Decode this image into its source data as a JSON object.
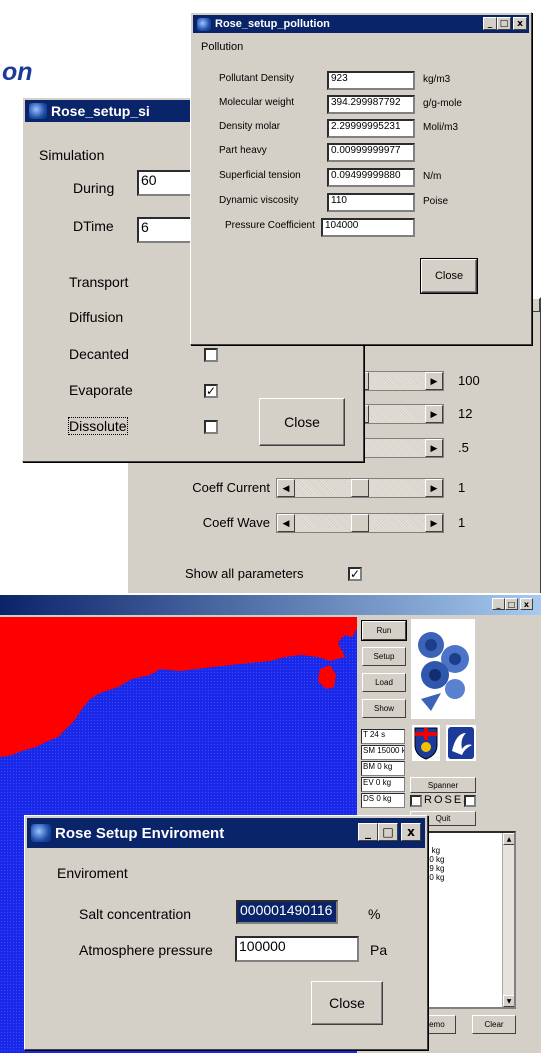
{
  "slide_title_fragment": "on",
  "sim_window": {
    "title": "Rose_setup_si",
    "group_label": "Simulation",
    "during_label": "During",
    "during_value": "60",
    "dtime_label": "DTime",
    "dtime_value": "6",
    "options": [
      {
        "label": "Transport",
        "checked": null
      },
      {
        "label": "Diffusion",
        "checked": null
      },
      {
        "label": "Decanted",
        "checked": false
      },
      {
        "label": "Evaporate",
        "checked": true
      },
      {
        "label": "Dissolute",
        "checked": false
      }
    ],
    "close_label": "Close"
  },
  "pollution_window": {
    "title": "Rose_setup_pollution",
    "group_label": "Pollution",
    "fields": [
      {
        "label": "Pollutant Density",
        "value": "923",
        "unit": "kg/m3"
      },
      {
        "label": "Molecular weight",
        "value": "394.299987792",
        "unit": "g/g-mole"
      },
      {
        "label": "Density molar",
        "value": "2.29999995231",
        "unit": "Moli/m3"
      },
      {
        "label": "Part heavy",
        "value": "0.00999999977",
        "unit": ""
      },
      {
        "label": "Superficial tension",
        "value": "0.09499999880",
        "unit": "N/m"
      },
      {
        "label": "Dynamic viscosity",
        "value": "110",
        "unit": "Poise"
      },
      {
        "label": "Pressure Coefficient",
        "value": "104000",
        "unit": ""
      }
    ],
    "close_label": "Close"
  },
  "params_window": {
    "sliders": [
      {
        "label": "",
        "value": "100",
        "level": 0.5
      },
      {
        "label": "",
        "value": "12",
        "level": 0.5
      },
      {
        "label": "",
        "value": ".5",
        "level": 0.05
      },
      {
        "label": "Coeff Current",
        "value": "1",
        "level": 0.5
      },
      {
        "label": "Coeff Wave",
        "value": "1",
        "level": 0.5
      }
    ],
    "show_all_label": "Show all parameters",
    "show_all_checked": true
  },
  "main_window": {
    "buttons": {
      "run": "Run",
      "setup": "Setup",
      "load": "Load",
      "show": "Show",
      "spanner": "Spanner",
      "quit": "Quit",
      "demo": "Demo",
      "clear": "Clear"
    },
    "status": [
      "T 24 s",
      "SM 15000 kg",
      "BM 0 kg",
      "EV 0 kg",
      "DS 0 kg"
    ],
    "roses_label": "ROSES",
    "log_lines": [
      "g",
      "000 kg",
      "5000 kg",
      "4999 kg",
      "5000 kg"
    ],
    "colors": {
      "sea": "#1a28e8",
      "land": "#ff0000"
    }
  },
  "env_window": {
    "title": "Rose Setup Enviroment",
    "group_label": "Enviroment",
    "salt_label": "Salt concentration",
    "salt_value": "000001490116",
    "salt_unit": "%",
    "pressure_label": "Atmosphere pressure",
    "pressure_value": "100000",
    "pressure_unit": "Pa",
    "close_label": "Close"
  }
}
